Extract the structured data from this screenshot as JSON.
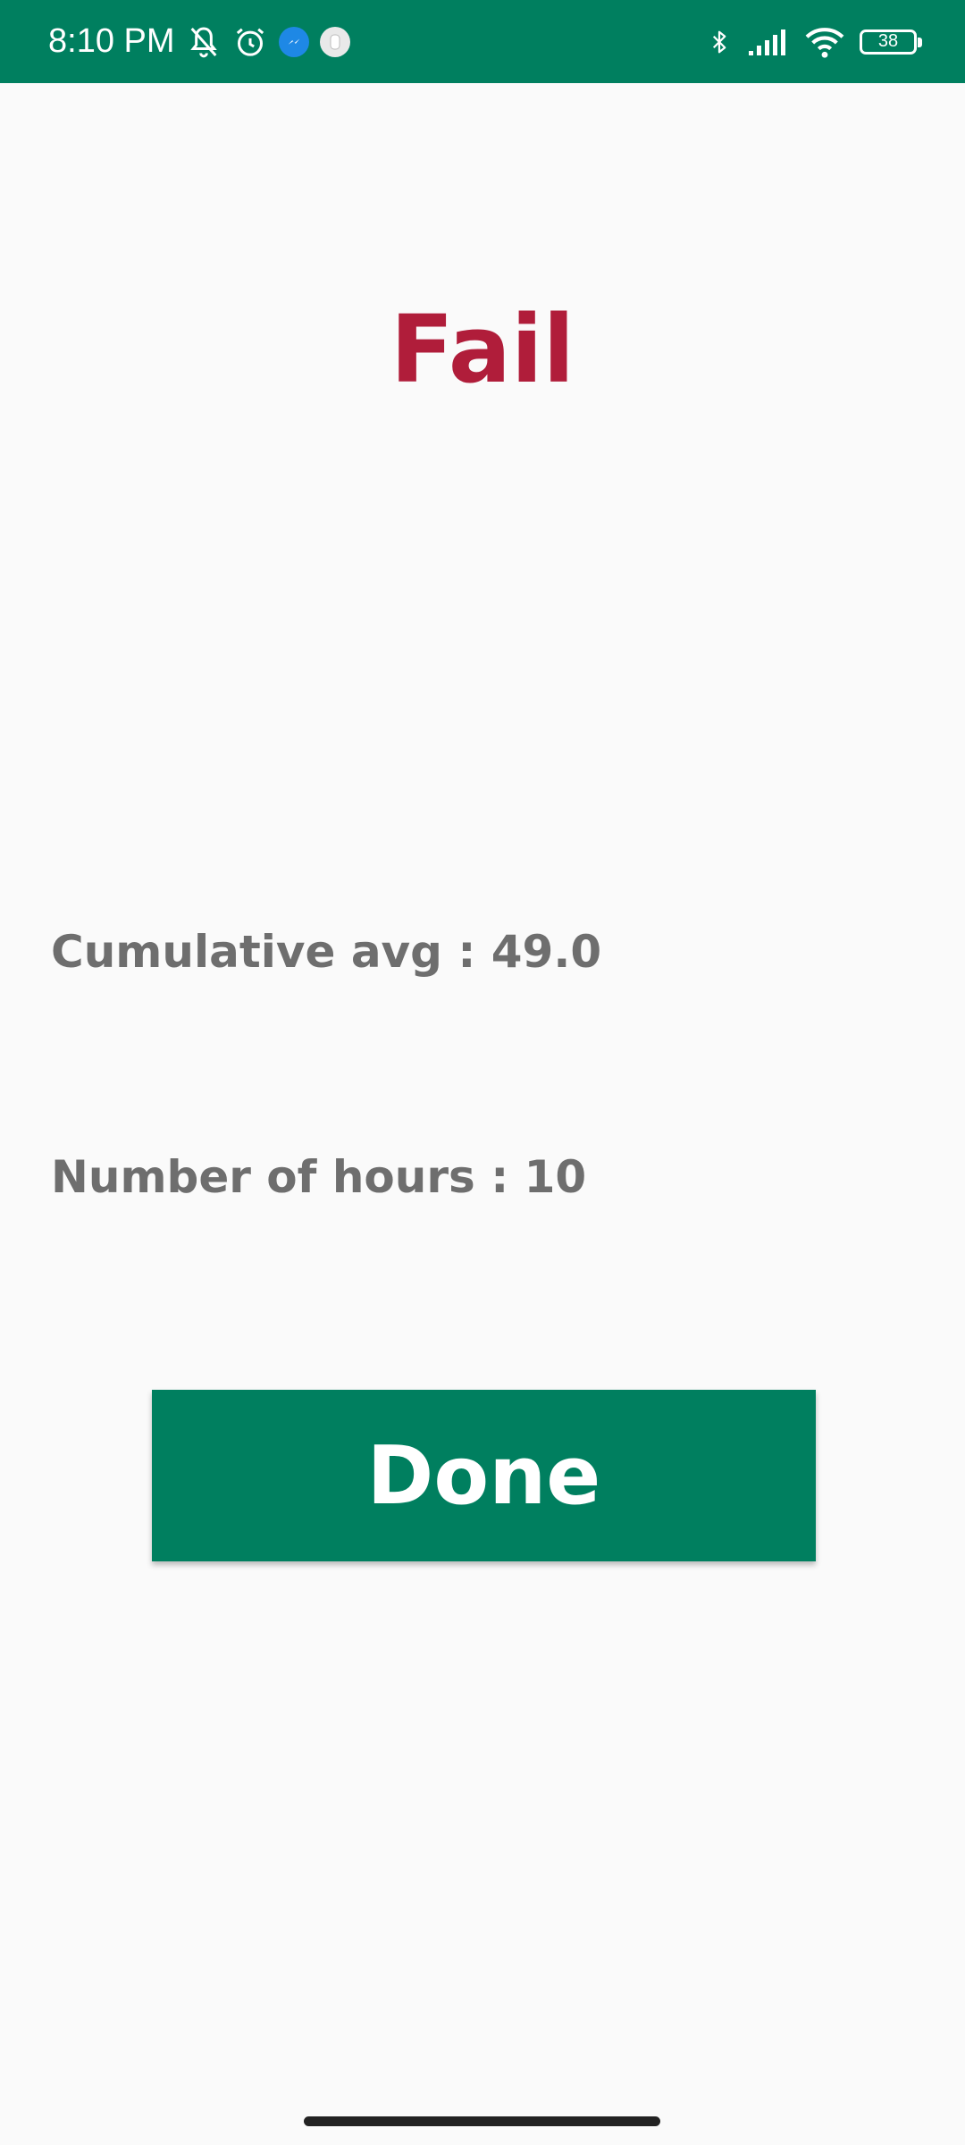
{
  "status_bar": {
    "time": "8:10 PM",
    "battery_level": "38",
    "icons_left": [
      "muted-bell-icon",
      "alarm-icon",
      "messenger-icon",
      "app-notification-icon"
    ],
    "icons_right": [
      "bluetooth-icon",
      "signal-icon",
      "wifi-icon",
      "battery-icon"
    ],
    "background_color": "#007f5f"
  },
  "result": {
    "title": "Fail",
    "title_color": "#b01d3a"
  },
  "stats": {
    "cumulative_avg": "Cumulative avg : 49.0",
    "number_of_hours": "Number of hours : 10"
  },
  "actions": {
    "done_label": "Done",
    "button_color": "#007f5f"
  }
}
